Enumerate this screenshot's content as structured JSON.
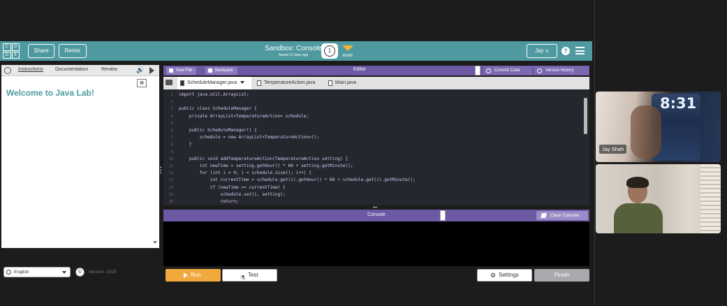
{
  "header": {
    "logo_letters": [
      "C",
      "O",
      "D",
      "E"
    ],
    "share_label": "Share",
    "remix_label": "Remix",
    "title": "Sandbox: Console",
    "saved_text": "Saved 12 days ago",
    "level_number": "1",
    "more_label": "MORE",
    "user_label": "Jay",
    "help_glyph": "?",
    "accent_color": "#4e9aa0"
  },
  "instructions": {
    "tabs": [
      {
        "label": "Instructions",
        "active": true
      },
      {
        "label": "Documentation",
        "active": false
      },
      {
        "label": "Review",
        "active": false
      }
    ],
    "welcome": "Welcome to Java Lab!"
  },
  "editor": {
    "new_file_label": "New File",
    "backpack_label": "Backpack",
    "title": "Editor",
    "commit_label": "Commit Code",
    "version_history_label": "Version History",
    "header_color": "#6c58a3",
    "files": [
      {
        "name": "ScheduleManager.java",
        "active": true
      },
      {
        "name": "TemperatureAction.java",
        "active": false
      },
      {
        "name": "Main.java",
        "active": false
      }
    ],
    "code_lines": [
      {
        "num": "1",
        "text": "import java.util.ArrayList;"
      },
      {
        "num": "2",
        "text": ""
      },
      {
        "num": "3",
        "text": "public class ScheduleManager {"
      },
      {
        "num": "4",
        "text": "    private ArrayList<TemperatureAction> schedule;"
      },
      {
        "num": "5",
        "text": ""
      },
      {
        "num": "6",
        "text": "    public ScheduleManager() {"
      },
      {
        "num": "7",
        "text": "        schedule = new ArrayList<TemperatureAction>();"
      },
      {
        "num": "8",
        "text": "    }"
      },
      {
        "num": "9",
        "text": ""
      },
      {
        "num": "10",
        "text": "    public void addTemperatureAction(TemperatureAction setting) {"
      },
      {
        "num": "11",
        "text": "        int newTime = setting.getHour() * 60 + setting.getMinute();"
      },
      {
        "num": "12",
        "text": "        for (int i = 0; i < schedule.size(); i++) {"
      },
      {
        "num": "13",
        "text": "            int currentTime = schedule.get(i).getHour() * 60 + schedule.get(i).getMinute();"
      },
      {
        "num": "14",
        "text": "            if (newTime == currentTime) {"
      },
      {
        "num": "15",
        "text": "                schedule.set(i, setting);"
      },
      {
        "num": "16",
        "text": "                return;"
      }
    ]
  },
  "console": {
    "title": "Console",
    "clear_label": "Clear Console"
  },
  "footer": {
    "language": "English",
    "copyright_glyph": "©",
    "version": "Version: 2025",
    "run_label": "Run",
    "test_label": "Test",
    "settings_label": "Settings",
    "finish_label": "Finish",
    "run_color": "#f1a83c"
  },
  "video": {
    "participant1_name": "Jay Shah",
    "phone_time": "8:31"
  }
}
